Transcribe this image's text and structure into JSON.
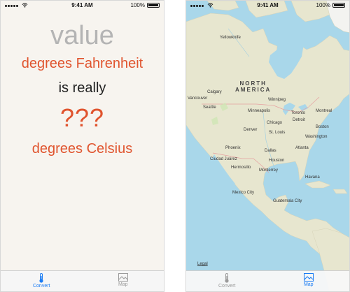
{
  "convert_screen": {
    "status_bar": {
      "time": "9:41 AM",
      "battery": "100%"
    },
    "value_placeholder": "value",
    "fahrenheit_label": "degrees Fahrenheit",
    "connector_text": "is really",
    "result_placeholder": "???",
    "celsius_label": "degrees Celsius",
    "tabs": [
      {
        "label": "Convert",
        "icon": "thermometer-icon",
        "state": "selected"
      },
      {
        "label": "Map",
        "icon": "map-icon",
        "state": "normal"
      }
    ]
  },
  "map_screen": {
    "status_bar": {
      "time": "9:41 AM",
      "battery": "100%"
    },
    "region_label": "NORTH AMERICA",
    "region_line1": "NORTH",
    "region_line2": "AMERICA",
    "cities": [
      "Yellowknife",
      "Calgary",
      "Vancouver",
      "Seattle",
      "Winnipeg",
      "Minneapolis",
      "Toronto",
      "Montreal",
      "Chicago",
      "Detroit",
      "Denver",
      "St. Louis",
      "Boston",
      "Washington",
      "Phoenix",
      "Dallas",
      "Atlanta",
      "Ciudad Juárez",
      "Houston",
      "Hermosillo",
      "Monterrey",
      "Havana",
      "Mexico City",
      "Guatemala City"
    ],
    "legal_link": "Legal",
    "tabs": [
      {
        "label": "Convert",
        "icon": "thermometer-icon",
        "state": "normal"
      },
      {
        "label": "Map",
        "icon": "map-icon",
        "state": "selected"
      }
    ]
  },
  "colors": {
    "accent": "#e0542e",
    "tab_selected": "#1a7cf4",
    "tab_normal": "#9b9b9b",
    "placeholder": "#b4b4b4",
    "convert_background": "#f7f4ef",
    "water": "#a9d7ea",
    "land": "#e7e6cf"
  }
}
